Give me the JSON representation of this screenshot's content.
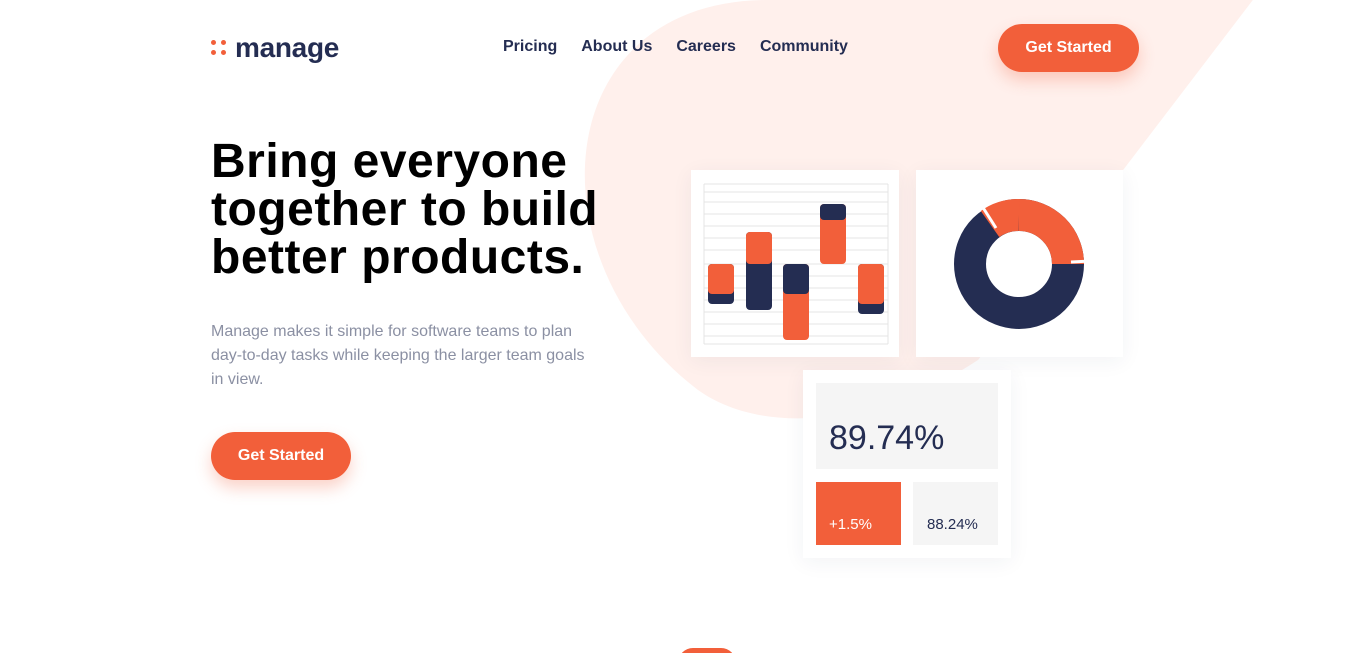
{
  "brand": {
    "name": "manage",
    "accent": "#f25f3a",
    "navy": "#242d52",
    "bg_tint": "#fff0ec"
  },
  "nav": [
    {
      "label": "Pricing"
    },
    {
      "label": "About Us"
    },
    {
      "label": "Careers"
    },
    {
      "label": "Community"
    }
  ],
  "header": {
    "cta_label": "Get Started"
  },
  "hero": {
    "title": "Bring everyone together to build better products.",
    "description": "Manage makes it simple for software teams to plan day-to-day tasks while keeping the larger team goals in view.",
    "cta_label": "Get Started"
  },
  "dashboard": {
    "stat_main": "89.74%",
    "stat_delta": "+1.5%",
    "stat_sub": "88.24%"
  }
}
